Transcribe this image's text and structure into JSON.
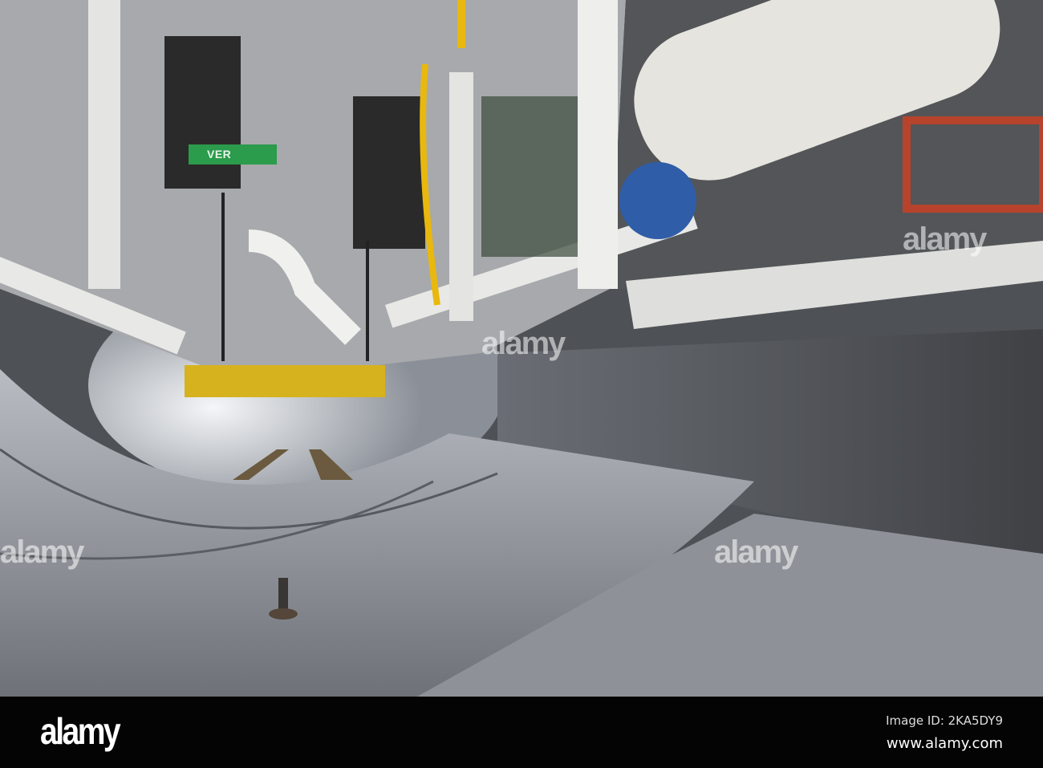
{
  "photo": {
    "subject": "tunnel boring machine interior",
    "label_on_hoist": "VER",
    "watermark": "alamy"
  },
  "footer": {
    "logo": "alamy",
    "image_id": "Image ID: 2KA5DY9",
    "website": "www.alamy.com"
  }
}
